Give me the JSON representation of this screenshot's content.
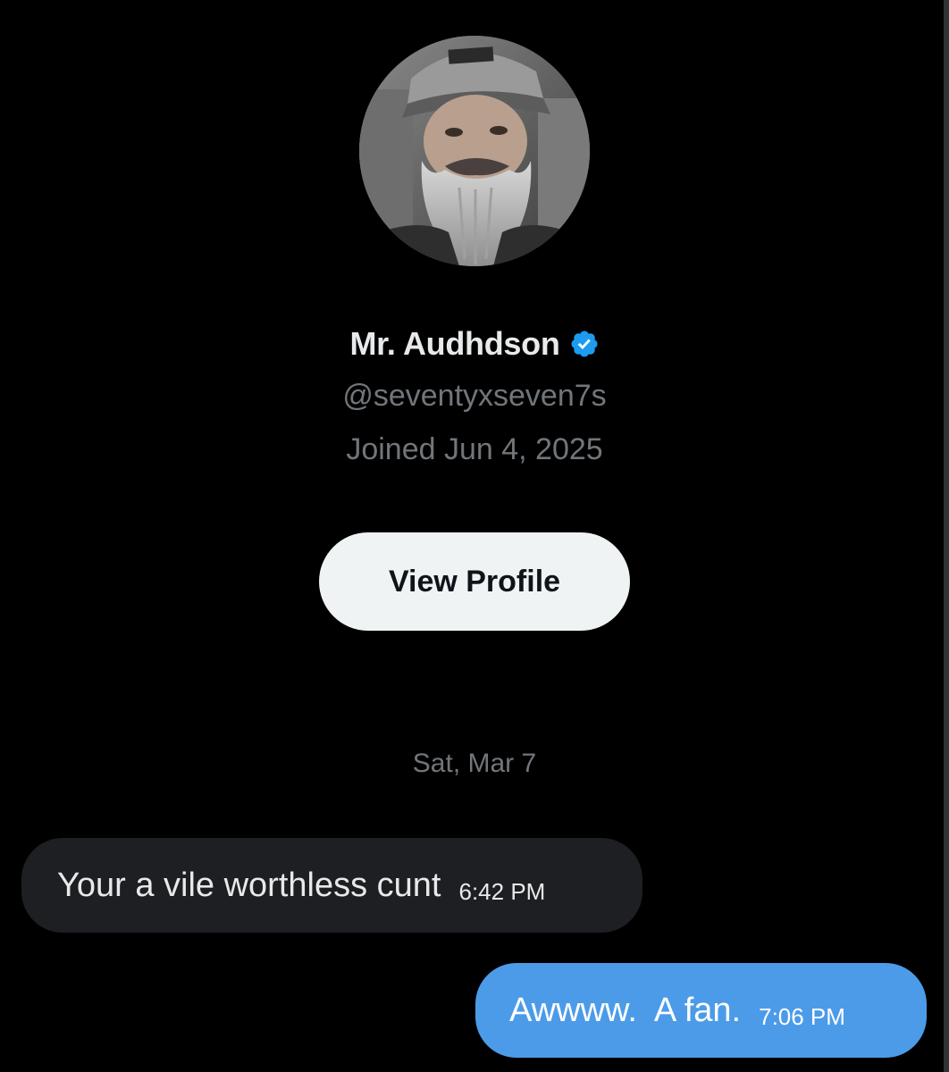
{
  "profile": {
    "avatar_icon": "user-avatar-photo",
    "display_name": "Mr. Audhdson",
    "verified_icon": "verified-badge-icon",
    "verified_color": "#1d9bf0",
    "handle": "@seventyxseven7s",
    "joined": "Joined Jun 4, 2025",
    "view_profile_label": "View Profile"
  },
  "conversation": {
    "date_separator": "Sat, Mar 7",
    "messages": [
      {
        "direction": "incoming",
        "text": "Your a vile worthless cunt",
        "time": "6:42 PM"
      },
      {
        "direction": "outgoing",
        "text": "Awwww.  A fan.",
        "time": "7:06 PM"
      }
    ]
  },
  "colors": {
    "background": "#000000",
    "incoming_bubble": "#1d1f22",
    "outgoing_bubble": "#4c9be8",
    "secondary_text": "#71767b",
    "button_bg": "#eff3f4"
  }
}
